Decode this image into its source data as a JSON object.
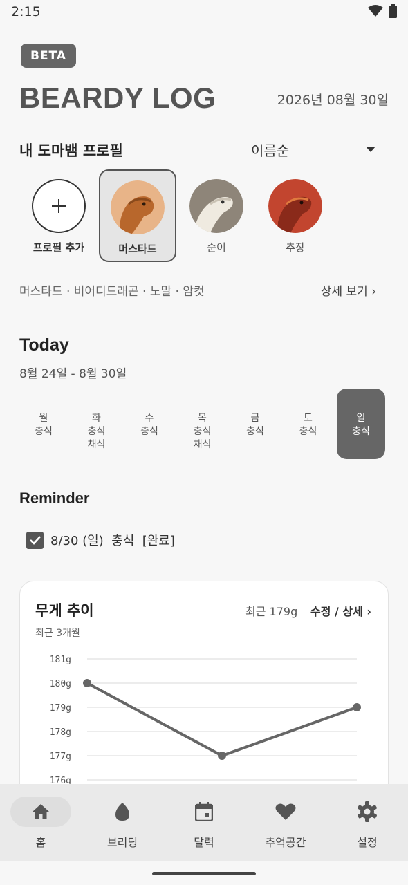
{
  "status_bar": {
    "time": "2:15"
  },
  "header": {
    "badge": "BETA",
    "title": "BEARDY LOG",
    "date": "2026년 08월 30일"
  },
  "profiles_section": {
    "title": "내 도마뱀 프로필",
    "sort": {
      "selected": "이름순"
    },
    "add_label": "프로필 추가",
    "profiles": [
      {
        "name": "머스타드",
        "selected": true
      },
      {
        "name": "순이",
        "selected": false
      },
      {
        "name": "추장",
        "selected": false
      }
    ],
    "summary": "머스타드 · 비어디드래곤 · 노말 · 암컷",
    "detail_link": "상세 보기 ›"
  },
  "today": {
    "title": "Today",
    "range": "8월 24일 - 8월 30일",
    "days": [
      {
        "day": "월",
        "items": [
          "충식"
        ],
        "active": false
      },
      {
        "day": "화",
        "items": [
          "충식",
          "채식"
        ],
        "active": false
      },
      {
        "day": "수",
        "items": [
          "충식"
        ],
        "active": false
      },
      {
        "day": "목",
        "items": [
          "충식",
          "채식"
        ],
        "active": false
      },
      {
        "day": "금",
        "items": [
          "충식"
        ],
        "active": false
      },
      {
        "day": "토",
        "items": [
          "충식"
        ],
        "active": false
      },
      {
        "day": "일",
        "items": [
          "충식"
        ],
        "active": true
      }
    ]
  },
  "reminder": {
    "title": "Reminder",
    "items": [
      {
        "text": "8/30 (일)  충식  [완료]",
        "checked": true
      }
    ]
  },
  "weight_card": {
    "title": "무게 추이",
    "recent": "최근 179g",
    "edit_link": "수정 / 상세 ›",
    "period": "최근 3개월"
  },
  "chart_data": {
    "type": "line",
    "x": [
      0,
      1,
      2
    ],
    "series": [
      {
        "values": [
          180,
          177,
          179
        ]
      }
    ],
    "y_ticks": [
      "181g",
      "180g",
      "179g",
      "178g",
      "177g",
      "176g"
    ],
    "ylim": [
      176,
      181
    ],
    "grid": true,
    "color": "#666666"
  },
  "bottom_nav": [
    {
      "label": "홈",
      "icon": "home-icon",
      "active": true
    },
    {
      "label": "브리딩",
      "icon": "egg-icon",
      "active": false
    },
    {
      "label": "달력",
      "icon": "calendar-icon",
      "active": false
    },
    {
      "label": "추억공간",
      "icon": "heart-icon",
      "active": false
    },
    {
      "label": "설정",
      "icon": "gear-icon",
      "active": false
    }
  ],
  "colors": {
    "accent": "#666666",
    "background": "#f7f7f7"
  }
}
